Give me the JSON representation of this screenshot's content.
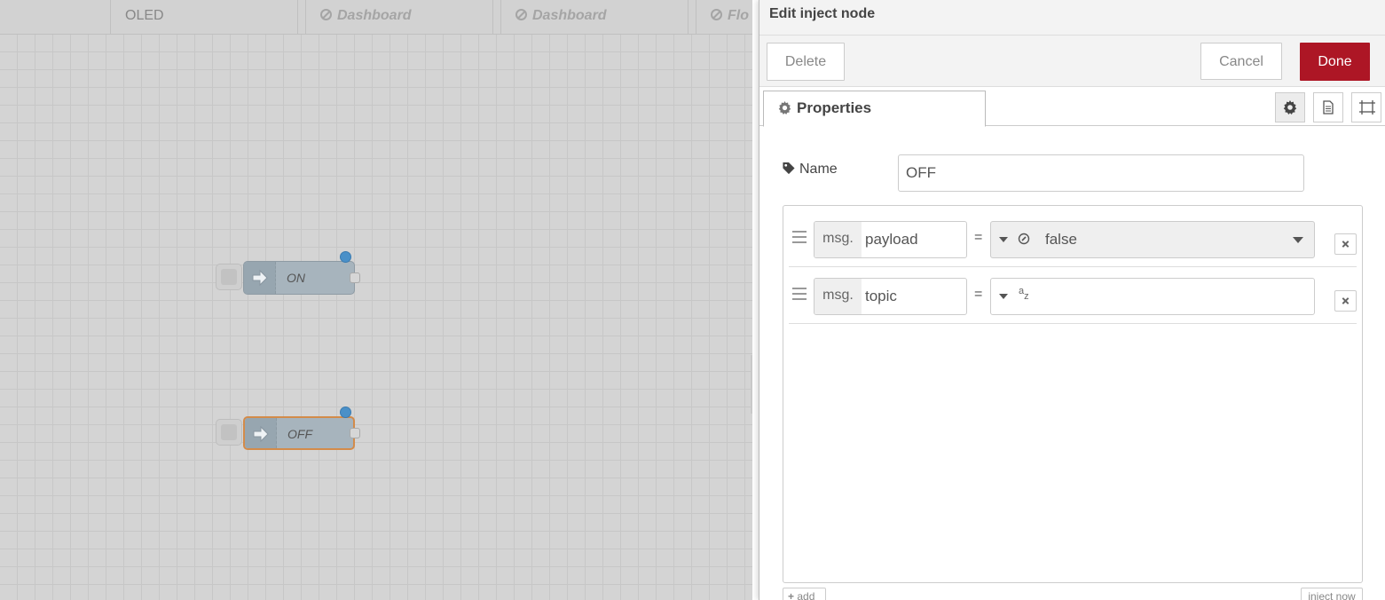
{
  "workspace": {
    "tabs": [
      {
        "label": "OLED",
        "disabled": false
      },
      {
        "label": "Dashboard",
        "disabled": true
      },
      {
        "label": "Dashboard",
        "disabled": true
      },
      {
        "label": "Flo",
        "disabled": true
      }
    ],
    "nodes": [
      {
        "label": "ON",
        "selected": false
      },
      {
        "label": "OFF",
        "selected": true
      }
    ]
  },
  "editor": {
    "title": "Edit inject node",
    "buttons": {
      "delete": "Delete",
      "cancel": "Cancel",
      "done": "Done"
    },
    "tab_properties": "Properties",
    "name": {
      "label": "Name",
      "value": "OFF"
    },
    "properties": [
      {
        "prefix": "msg.",
        "key": "payload",
        "eq": "=",
        "type_icon": "boolean-icon",
        "value": "false"
      },
      {
        "prefix": "msg.",
        "key": "topic",
        "eq": "=",
        "type_icon": "string-az-icon",
        "value": ""
      }
    ],
    "type_string_glyph": {
      "a": "a",
      "z": "z"
    },
    "add_label": "add",
    "inject_now_label": "inject now"
  },
  "colors": {
    "done": "#ad1625",
    "selected_outline": "#d38b4a",
    "changed_dot": "#4a90c8",
    "node_fill": "#a7b4bd"
  }
}
